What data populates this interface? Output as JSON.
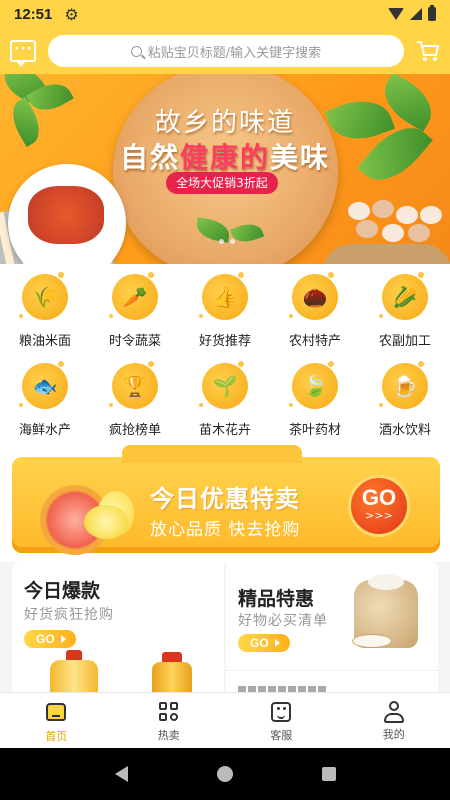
{
  "status": {
    "time": "12:51"
  },
  "search": {
    "placeholder": "粘贴宝贝标题/输入关键字搜索"
  },
  "banner": {
    "title_line1": "故乡的味道",
    "title_line2_part1": "自然",
    "title_line2_highlight": "健康的",
    "title_line2_part2": "美味",
    "tag": "全场大促销3折起"
  },
  "categories": [
    {
      "label": "粮油米面",
      "icon": "grain-icon",
      "glyph": "🌾"
    },
    {
      "label": "时令蔬菜",
      "icon": "carrot-icon",
      "glyph": "🥕"
    },
    {
      "label": "好货推荐",
      "icon": "thumbs-up-icon",
      "glyph": "👍"
    },
    {
      "label": "农村特产",
      "icon": "nuts-icon",
      "glyph": "🌰"
    },
    {
      "label": "农副加工",
      "icon": "corn-icon",
      "glyph": "🌽"
    },
    {
      "label": "海鲜水产",
      "icon": "fish-icon",
      "glyph": "🐟"
    },
    {
      "label": "疯抢榜单",
      "icon": "trophy-icon",
      "glyph": "🏆"
    },
    {
      "label": "苗木花卉",
      "icon": "seedling-icon",
      "glyph": "🌱"
    },
    {
      "label": "茶叶药材",
      "icon": "tea-leaf-icon",
      "glyph": "🍃"
    },
    {
      "label": "酒水饮料",
      "icon": "beer-icon",
      "glyph": "🍺"
    }
  ],
  "promo": {
    "title": "今日优惠特卖",
    "subtitle": "放心品质 快去抢购",
    "go_label": "GO",
    "go_arrow": ">>>"
  },
  "feature": {
    "left": {
      "title": "今日爆款",
      "subtitle": "好货疯狂抢购",
      "go_label": "GO"
    },
    "right": {
      "title": "精品特惠",
      "subtitle": "好物必买清单",
      "go_label": "GO"
    }
  },
  "nav": [
    {
      "label": "首页",
      "icon": "home-icon",
      "active": true
    },
    {
      "label": "热卖",
      "icon": "grid-icon",
      "active": false
    },
    {
      "label": "客服",
      "icon": "customer-service-icon",
      "active": false
    },
    {
      "label": "我的",
      "icon": "user-icon",
      "active": false
    }
  ],
  "colors": {
    "brand_yellow": "#ffd447",
    "accent_orange": "#f7a916",
    "active_nav": "#e8a100",
    "sale_red": "#e8234b"
  }
}
